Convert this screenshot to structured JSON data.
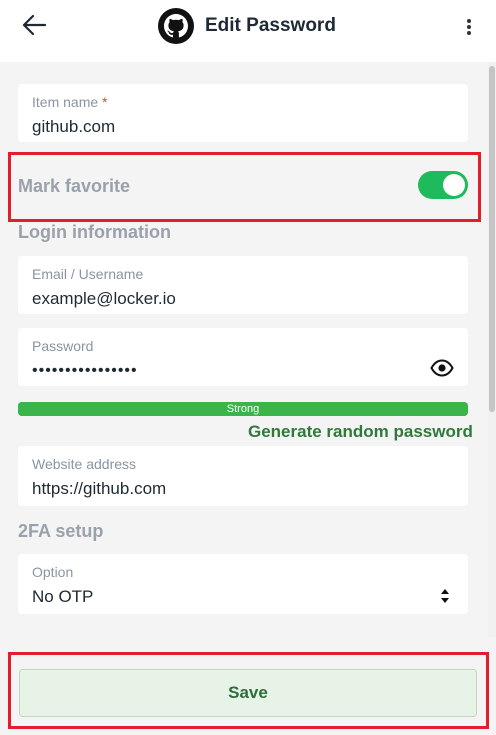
{
  "header": {
    "title": "Edit Password"
  },
  "form": {
    "item_name": {
      "label": "Item name",
      "required_mark": "*",
      "value": "github.com"
    },
    "favorite": {
      "label": "Mark favorite",
      "enabled": true
    },
    "login_section": "Login information",
    "email": {
      "label": "Email / Username",
      "value": "example@locker.io"
    },
    "password": {
      "label": "Password",
      "value": "••••••••••••••••"
    },
    "strength": {
      "label": "Strong",
      "level": 1.0,
      "color": "#3bb54a"
    },
    "generate_link": "Generate random password",
    "website": {
      "label": "Website address",
      "value": "https://github.com"
    },
    "twofa_section": "2FA setup",
    "option": {
      "label": "Option",
      "value": "No OTP"
    }
  },
  "actions": {
    "save_label": "Save"
  },
  "colors": {
    "accent_green": "#1fba5c",
    "highlight_red": "#e11d2e"
  }
}
